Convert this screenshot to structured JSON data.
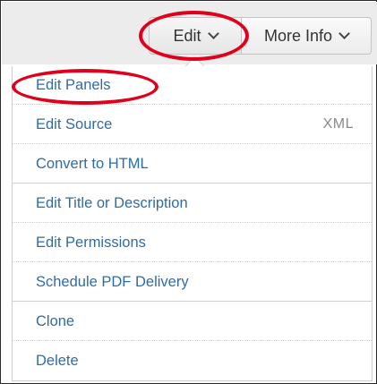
{
  "toolbar": {
    "edit_label": "Edit",
    "more_info_label": "More Info"
  },
  "menu": {
    "items": [
      {
        "label": "Edit Panels",
        "hint": ""
      },
      {
        "label": "Edit Source",
        "hint": "XML"
      },
      {
        "label": "Convert to HTML",
        "hint": ""
      },
      {
        "label": "Edit Title or Description",
        "hint": ""
      },
      {
        "label": "Edit Permissions",
        "hint": ""
      },
      {
        "label": "Schedule PDF Delivery",
        "hint": ""
      },
      {
        "label": "Clone",
        "hint": ""
      },
      {
        "label": "Delete",
        "hint": ""
      }
    ]
  },
  "colors": {
    "link": "#2f6ca5",
    "annotation": "#e0001b",
    "toolbar_bg": "#ececec"
  }
}
